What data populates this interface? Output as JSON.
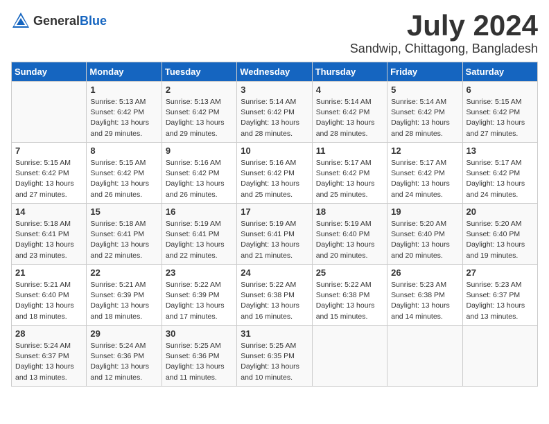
{
  "header": {
    "logo_general": "General",
    "logo_blue": "Blue",
    "month": "July 2024",
    "location": "Sandwip, Chittagong, Bangladesh"
  },
  "weekdays": [
    "Sunday",
    "Monday",
    "Tuesday",
    "Wednesday",
    "Thursday",
    "Friday",
    "Saturday"
  ],
  "weeks": [
    [
      {
        "day": "",
        "info": ""
      },
      {
        "day": "1",
        "info": "Sunrise: 5:13 AM\nSunset: 6:42 PM\nDaylight: 13 hours\nand 29 minutes."
      },
      {
        "day": "2",
        "info": "Sunrise: 5:13 AM\nSunset: 6:42 PM\nDaylight: 13 hours\nand 29 minutes."
      },
      {
        "day": "3",
        "info": "Sunrise: 5:14 AM\nSunset: 6:42 PM\nDaylight: 13 hours\nand 28 minutes."
      },
      {
        "day": "4",
        "info": "Sunrise: 5:14 AM\nSunset: 6:42 PM\nDaylight: 13 hours\nand 28 minutes."
      },
      {
        "day": "5",
        "info": "Sunrise: 5:14 AM\nSunset: 6:42 PM\nDaylight: 13 hours\nand 28 minutes."
      },
      {
        "day": "6",
        "info": "Sunrise: 5:15 AM\nSunset: 6:42 PM\nDaylight: 13 hours\nand 27 minutes."
      }
    ],
    [
      {
        "day": "7",
        "info": "Sunrise: 5:15 AM\nSunset: 6:42 PM\nDaylight: 13 hours\nand 27 minutes."
      },
      {
        "day": "8",
        "info": "Sunrise: 5:15 AM\nSunset: 6:42 PM\nDaylight: 13 hours\nand 26 minutes."
      },
      {
        "day": "9",
        "info": "Sunrise: 5:16 AM\nSunset: 6:42 PM\nDaylight: 13 hours\nand 26 minutes."
      },
      {
        "day": "10",
        "info": "Sunrise: 5:16 AM\nSunset: 6:42 PM\nDaylight: 13 hours\nand 25 minutes."
      },
      {
        "day": "11",
        "info": "Sunrise: 5:17 AM\nSunset: 6:42 PM\nDaylight: 13 hours\nand 25 minutes."
      },
      {
        "day": "12",
        "info": "Sunrise: 5:17 AM\nSunset: 6:42 PM\nDaylight: 13 hours\nand 24 minutes."
      },
      {
        "day": "13",
        "info": "Sunrise: 5:17 AM\nSunset: 6:42 PM\nDaylight: 13 hours\nand 24 minutes."
      }
    ],
    [
      {
        "day": "14",
        "info": "Sunrise: 5:18 AM\nSunset: 6:41 PM\nDaylight: 13 hours\nand 23 minutes."
      },
      {
        "day": "15",
        "info": "Sunrise: 5:18 AM\nSunset: 6:41 PM\nDaylight: 13 hours\nand 22 minutes."
      },
      {
        "day": "16",
        "info": "Sunrise: 5:19 AM\nSunset: 6:41 PM\nDaylight: 13 hours\nand 22 minutes."
      },
      {
        "day": "17",
        "info": "Sunrise: 5:19 AM\nSunset: 6:41 PM\nDaylight: 13 hours\nand 21 minutes."
      },
      {
        "day": "18",
        "info": "Sunrise: 5:19 AM\nSunset: 6:40 PM\nDaylight: 13 hours\nand 20 minutes."
      },
      {
        "day": "19",
        "info": "Sunrise: 5:20 AM\nSunset: 6:40 PM\nDaylight: 13 hours\nand 20 minutes."
      },
      {
        "day": "20",
        "info": "Sunrise: 5:20 AM\nSunset: 6:40 PM\nDaylight: 13 hours\nand 19 minutes."
      }
    ],
    [
      {
        "day": "21",
        "info": "Sunrise: 5:21 AM\nSunset: 6:40 PM\nDaylight: 13 hours\nand 18 minutes."
      },
      {
        "day": "22",
        "info": "Sunrise: 5:21 AM\nSunset: 6:39 PM\nDaylight: 13 hours\nand 18 minutes."
      },
      {
        "day": "23",
        "info": "Sunrise: 5:22 AM\nSunset: 6:39 PM\nDaylight: 13 hours\nand 17 minutes."
      },
      {
        "day": "24",
        "info": "Sunrise: 5:22 AM\nSunset: 6:38 PM\nDaylight: 13 hours\nand 16 minutes."
      },
      {
        "day": "25",
        "info": "Sunrise: 5:22 AM\nSunset: 6:38 PM\nDaylight: 13 hours\nand 15 minutes."
      },
      {
        "day": "26",
        "info": "Sunrise: 5:23 AM\nSunset: 6:38 PM\nDaylight: 13 hours\nand 14 minutes."
      },
      {
        "day": "27",
        "info": "Sunrise: 5:23 AM\nSunset: 6:37 PM\nDaylight: 13 hours\nand 13 minutes."
      }
    ],
    [
      {
        "day": "28",
        "info": "Sunrise: 5:24 AM\nSunset: 6:37 PM\nDaylight: 13 hours\nand 13 minutes."
      },
      {
        "day": "29",
        "info": "Sunrise: 5:24 AM\nSunset: 6:36 PM\nDaylight: 13 hours\nand 12 minutes."
      },
      {
        "day": "30",
        "info": "Sunrise: 5:25 AM\nSunset: 6:36 PM\nDaylight: 13 hours\nand 11 minutes."
      },
      {
        "day": "31",
        "info": "Sunrise: 5:25 AM\nSunset: 6:35 PM\nDaylight: 13 hours\nand 10 minutes."
      },
      {
        "day": "",
        "info": ""
      },
      {
        "day": "",
        "info": ""
      },
      {
        "day": "",
        "info": ""
      }
    ]
  ]
}
